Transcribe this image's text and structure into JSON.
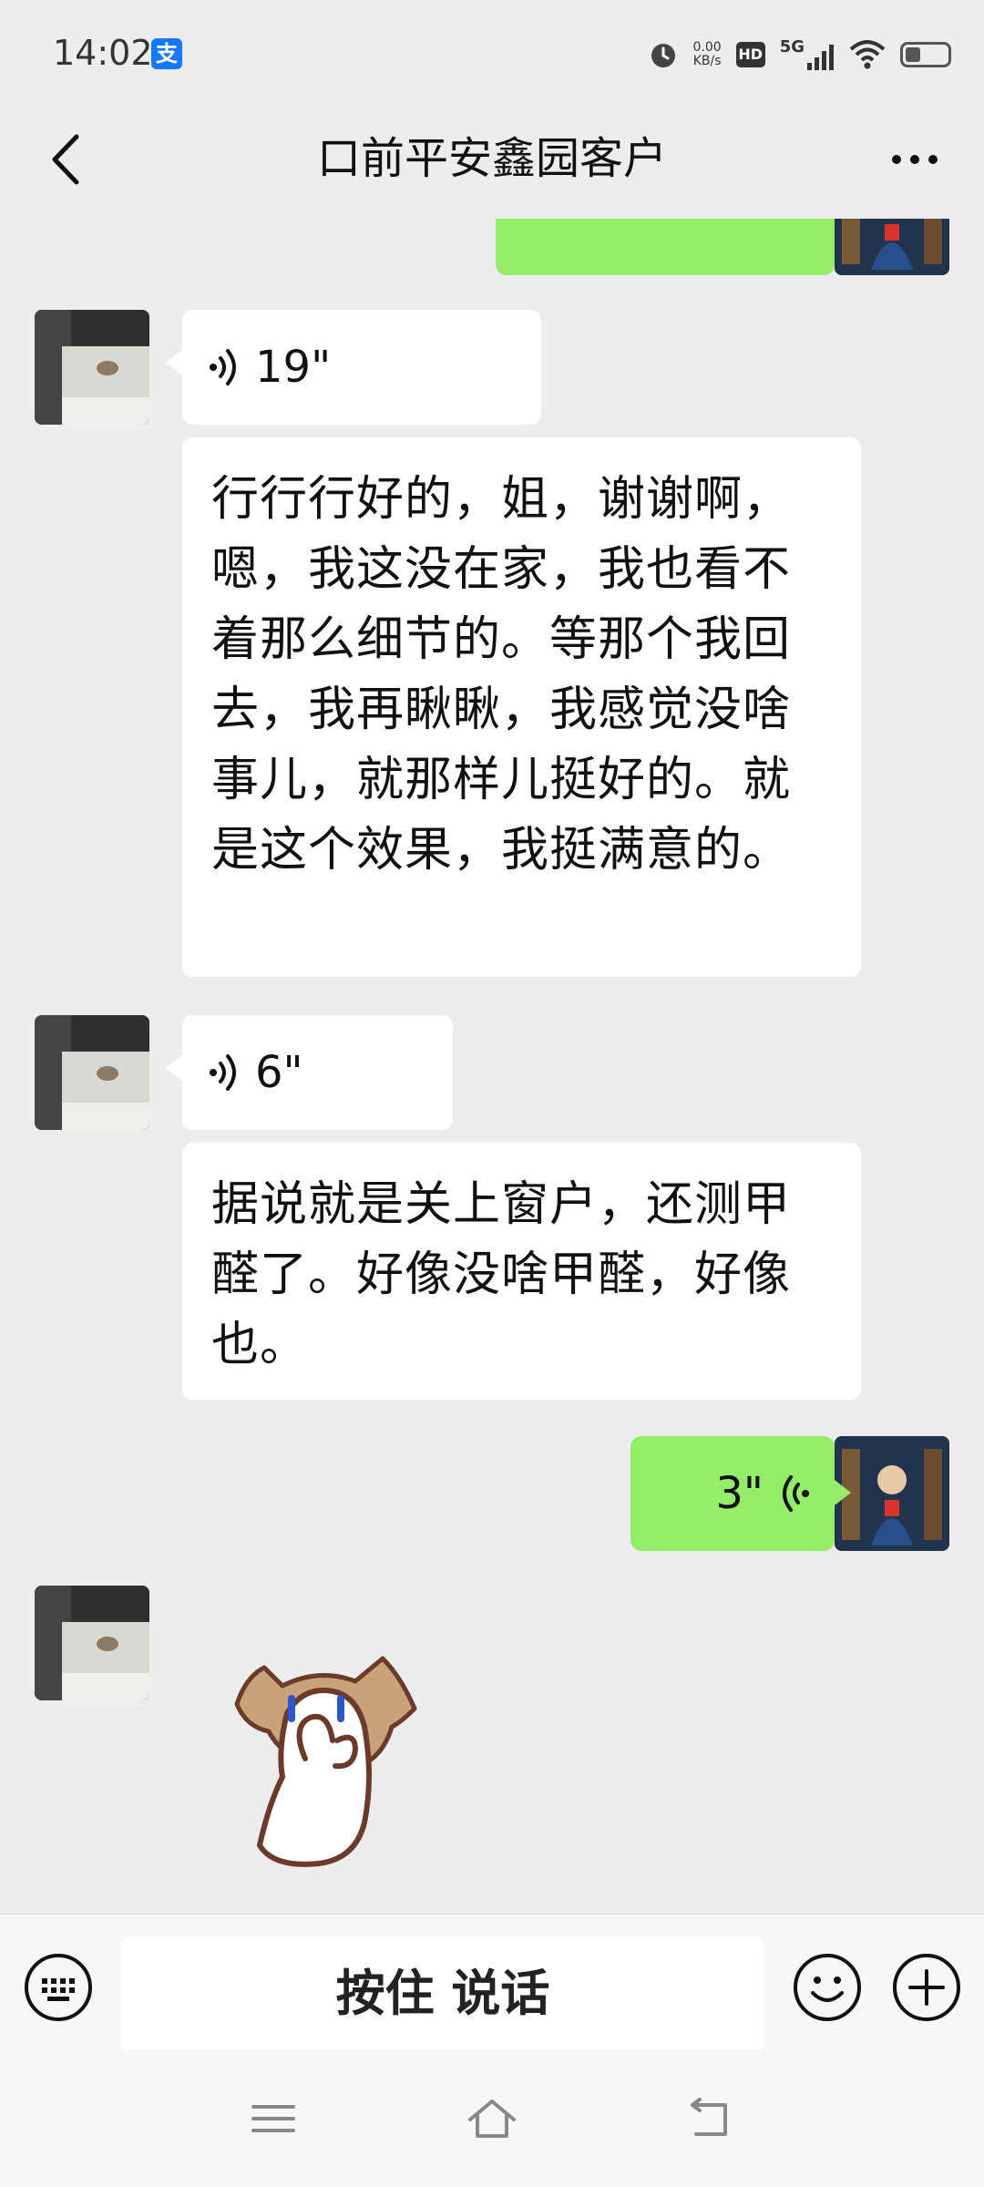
{
  "status_bar": {
    "time": "14:02",
    "alipay_glyph": "支",
    "net_speed_value": "0.00",
    "net_speed_unit": "KB/s",
    "hd_label": "HD",
    "network_label": "5G"
  },
  "nav": {
    "title": "口前平安鑫园客户"
  },
  "messages": [
    {
      "type": "voice",
      "direction": "in",
      "duration": "19\""
    },
    {
      "type": "transcript",
      "direction": "in",
      "text": "行行行好的，姐，谢谢啊，嗯，我这没在家，我也看不着那么细节的。等那个我回去，我再瞅瞅，我感觉没啥事儿，就那样儿挺好的。就是这个效果，我挺满意的。"
    },
    {
      "type": "voice",
      "direction": "in",
      "duration": "6\""
    },
    {
      "type": "transcript",
      "direction": "in",
      "text": "据说就是关上窗户，还测甲醛了。好像没啥甲醛，好像也。"
    },
    {
      "type": "voice",
      "direction": "out",
      "duration": "3\""
    },
    {
      "type": "sticker",
      "direction": "in"
    }
  ],
  "input_bar": {
    "hold_to_talk_label": "按住 说话"
  },
  "colors": {
    "outgoing_bubble": "#95ec69",
    "incoming_bubble": "#ffffff",
    "chat_background": "#ededed"
  },
  "icons": [
    "back-arrow-icon",
    "more-icon",
    "keyboard-icon",
    "emoji-icon",
    "plus-icon",
    "menu-icon",
    "home-icon",
    "back-nav-icon",
    "voice-wave-icon"
  ]
}
